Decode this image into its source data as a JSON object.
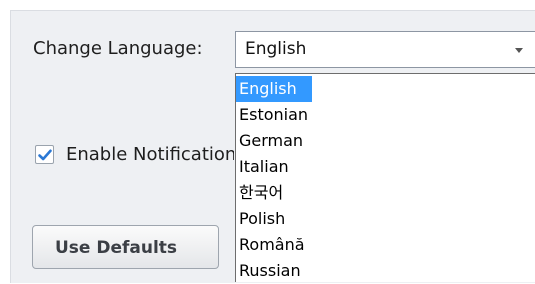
{
  "settings": {
    "change_language_label": "Change Language:",
    "language_selected": "English",
    "language_options": [
      "English",
      "Estonian",
      "German",
      "Italian",
      "한국어",
      "Polish",
      "Română",
      "Russian"
    ],
    "enable_notifications_label": "Enable Notifications",
    "enable_notifications_checked": true,
    "use_defaults_label": "Use Defaults"
  },
  "colors": {
    "selection_highlight": "#3399ff",
    "checkmark": "#2b78d4",
    "panel_background": "#eef0f3"
  },
  "icons": {
    "dropdown": "chevron-down-icon",
    "checkbox": "checkmark-icon"
  }
}
